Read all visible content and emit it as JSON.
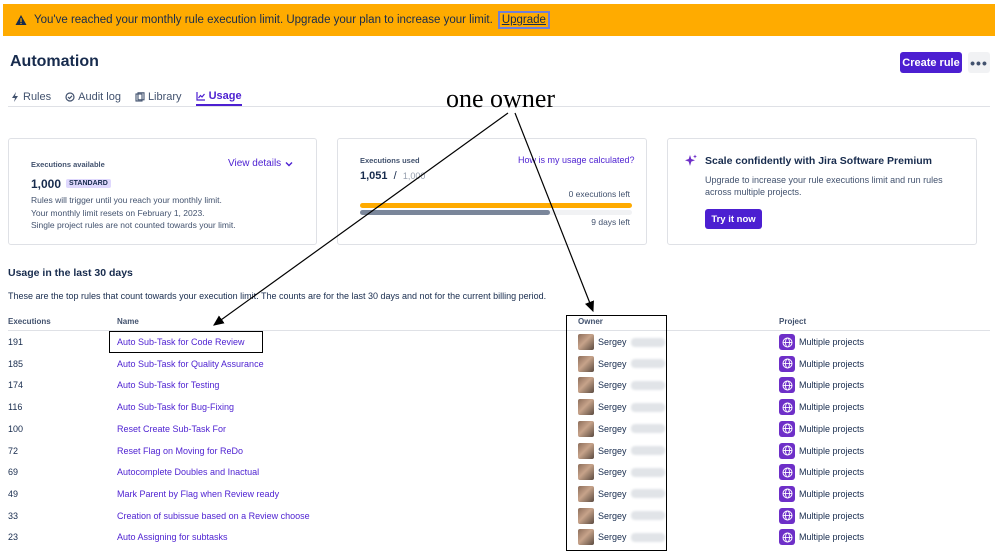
{
  "banner": {
    "message": "You've reached your monthly rule execution limit. Upgrade your plan to increase your limit.",
    "link": "Upgrade",
    "color": "#FFAB00"
  },
  "header": {
    "title": "Automation",
    "create_button": "Create rule",
    "more_icon": "ellipsis-icon"
  },
  "tabs": [
    {
      "label": "Rules",
      "icon": "bolt-icon"
    },
    {
      "label": "Audit log",
      "icon": "check-circle-icon"
    },
    {
      "label": "Library",
      "icon": "copy-icon"
    },
    {
      "label": "Usage",
      "icon": "chart-icon",
      "active": true
    }
  ],
  "cards": {
    "available": {
      "label": "Executions available",
      "view_details": "View details",
      "value": "1,000",
      "badge": "STANDARD",
      "line1": "Rules will trigger until you reach your monthly limit.",
      "line2": "Your monthly limit resets on February 1, 2023.",
      "line3": "Single project rules are not counted towards your limit."
    },
    "used": {
      "label": "Executions used",
      "how_link": "How is my usage calculated?",
      "value": "1,051",
      "separator": "/",
      "limit": "1,000",
      "executions_left": "0 executions left",
      "days_left": "9 days left",
      "executions_fraction": 1.0,
      "days_fraction": 0.7
    },
    "premium": {
      "title": "Scale confidently with Jira Software Premium",
      "desc": "Upgrade to increase your rule executions limit and run rules across multiple projects.",
      "button": "Try it now",
      "icon": "sparkle-icon"
    }
  },
  "usage": {
    "title": "Usage in the last 30 days",
    "desc": "These are the top rules that count towards your execution limit. The counts are for the last 30 days and not for the current billing period.",
    "columns": {
      "executions": "Executions",
      "name": "Name",
      "owner": "Owner",
      "project": "Project"
    },
    "rows": [
      {
        "executions": "191",
        "name": "Auto Sub-Task for Code Review",
        "owner": "Sergey",
        "project": "Multiple projects"
      },
      {
        "executions": "185",
        "name": "Auto Sub-Task for Quality Assurance",
        "owner": "Sergey",
        "project": "Multiple projects"
      },
      {
        "executions": "174",
        "name": "Auto Sub-Task for Testing",
        "owner": "Sergey",
        "project": "Multiple projects"
      },
      {
        "executions": "116",
        "name": "Auto Sub-Task for Bug-Fixing",
        "owner": "Sergey",
        "project": "Multiple projects"
      },
      {
        "executions": "100",
        "name": "Reset Create Sub-Task For",
        "owner": "Sergey",
        "project": "Multiple projects"
      },
      {
        "executions": "72",
        "name": "Reset Flag on Moving for ReDo",
        "owner": "Sergey",
        "project": "Multiple projects"
      },
      {
        "executions": "69",
        "name": "Autocomplete Doubles and Inactual",
        "owner": "Sergey",
        "project": "Multiple projects"
      },
      {
        "executions": "49",
        "name": "Mark Parent by Flag when Review ready",
        "owner": "Sergey",
        "project": "Multiple projects"
      },
      {
        "executions": "33",
        "name": "Creation of subissue based on a Review choose",
        "owner": "Sergey",
        "project": "Multiple projects"
      },
      {
        "executions": "23",
        "name": "Auto Assigning for subtasks",
        "owner": "Sergey",
        "project": "Multiple projects"
      }
    ]
  },
  "annotation": {
    "text": "one  owner"
  },
  "colors": {
    "accent": "#4C1FD1",
    "text": "#172B4D",
    "subtle": "#42526E",
    "warning": "#FFAB00"
  }
}
